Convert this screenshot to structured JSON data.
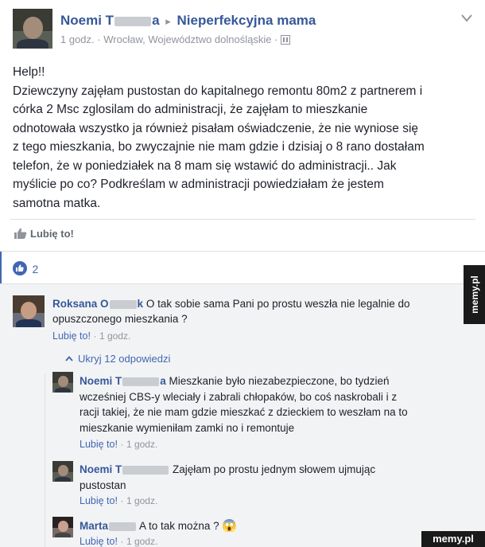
{
  "post": {
    "author_first": "Noemi T",
    "author_suffix": "a",
    "arrow": "▸",
    "group": "Nieperfekcyjna mama",
    "time": "1 godz.",
    "dot": "·",
    "location": "Wrocław, Województwo dolnośląskie",
    "dot2": "·",
    "text_lines": [
      "Help!!",
      "Dziewczyny zajęłam pustostan do kapitalnego remontu 80m2 z partnerem i",
      "córka 2 Msc zglosilam do administracji, że zajęłam to mieszkanie",
      "odnotowała wszystko ja również pisałam oświadczenie, że nie wyniose się",
      "z tego mieszkania, bo zwyczajnie nie mam gdzie i dzisiaj o 8 rano dostałam",
      "telefon, że w poniedziałek na 8 mam się wstawić do administracji.. Jak",
      "myślicie po co? Podkreślam w administracji powiedziałam że jestem",
      "samotna matka."
    ],
    "like_action": "Lubię to!",
    "reactions_count": "2"
  },
  "comments": {
    "c1": {
      "name_first": "Roksana O",
      "name_suffix": "k",
      "text_line1": "O tak sobie sama Pani po prostu weszła nie legalnie do",
      "text_line2": "opuszczonego mieszkania ?",
      "like": "Lubię to!",
      "dot": "·",
      "time": "1 godz."
    },
    "hide_replies": "Ukryj 12 odpowiedzi",
    "r1": {
      "name_first": "Noemi T",
      "name_suffix": "a",
      "lines": [
        "Mieszkanie było niezabezpieczone, bo tydzień",
        "wcześniej CBS-y wleciały i zabrali chłopaków, bo coś naskrobali i z",
        "racji takiej, że nie mam gdzie mieszkać z dzieckiem to weszłam na to",
        "mieszkanie wymieniłam zamki no i remontuje"
      ],
      "like": "Lubię to!",
      "dot": "·",
      "time": "1 godz."
    },
    "r2": {
      "name_first": "Noemi T",
      "name_suffix": "",
      "line1": "Zajęłam po prostu jednym słowem ujmując",
      "line2": "pustostan",
      "like": "Lubię to!",
      "dot": "·",
      "time": "1 godz."
    },
    "r3": {
      "name_first": "Marta",
      "text": "A to tak można ?",
      "emoji": "😱",
      "like": "Lubię to!",
      "dot": "·",
      "time": "1 godz."
    }
  },
  "watermark": {
    "side": "memy.pl",
    "bottom": "memy.pl"
  },
  "colors": {
    "link": "#365899",
    "meta": "#90949c",
    "like_blue": "#4267b2",
    "watermark_bg": "#1a1a1a"
  }
}
